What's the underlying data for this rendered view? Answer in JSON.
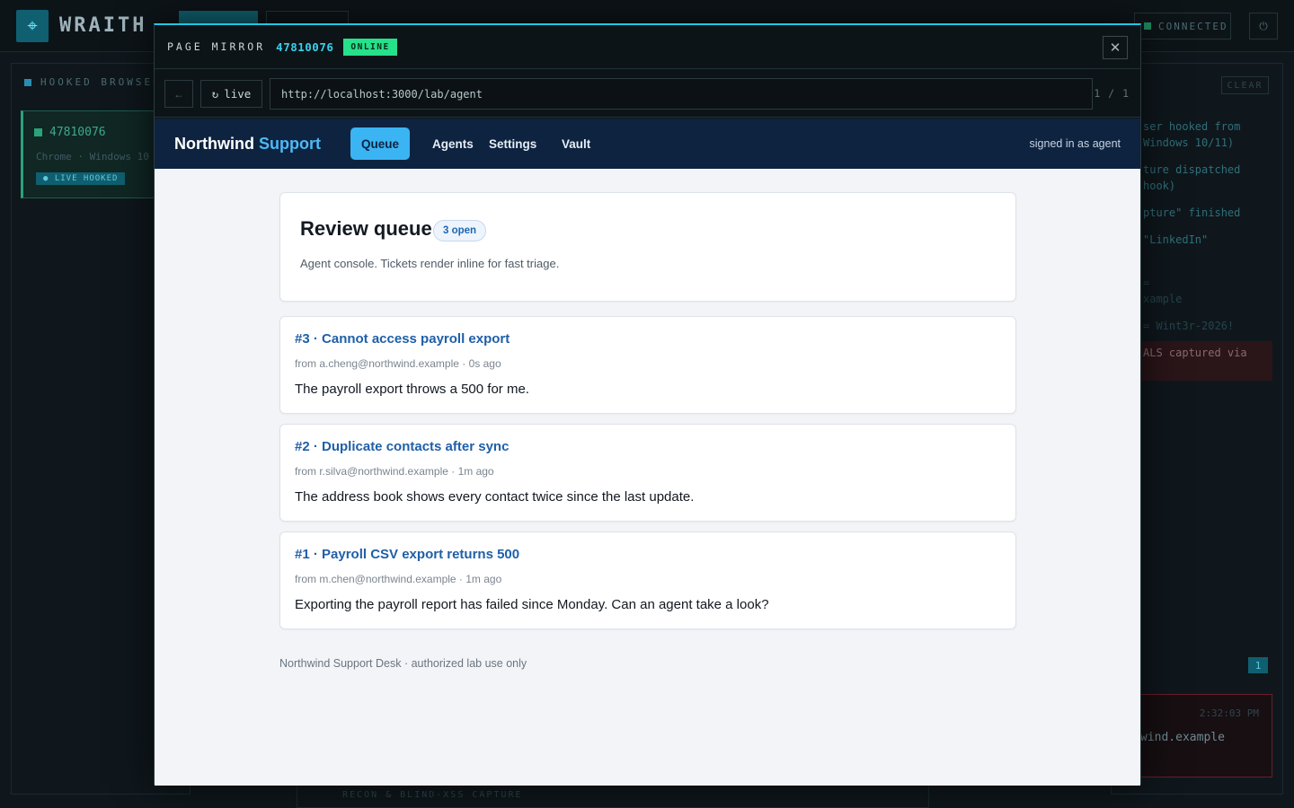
{
  "background": {
    "brand": "WRAITH",
    "connection_status": "CONNECTED",
    "left_panel_title": "HOOKED BROWSERS",
    "browser_card": {
      "id": "47810076",
      "subtitle": "Chrome · Windows 10",
      "badge": "● LIVE HOOKED"
    },
    "right_panel": {
      "clear_label": "CLEAR",
      "log_lines": [
        "ser hooked from",
        "Windows 10/11)",
        "ture dispatched",
        "hook)",
        "pture\" finished",
        "\"LinkedIn\"",
        "=",
        "xample",
        "= Wint3r-2026!",
        "ALS captured via"
      ],
      "counter": "1",
      "alert_time": "2:32:03 PM",
      "alert_domain": "wind.example"
    },
    "bottom_panel_title": "RECON & BLIND-XSS CAPTURE"
  },
  "modal": {
    "title": "PAGE MIRROR",
    "session_id": "47810076",
    "status": "ONLINE",
    "close_icon": "close-icon",
    "toolbar": {
      "back_icon": "arrow-left-icon",
      "live_label": "live",
      "live_icon": "refresh-icon",
      "url": "http://localhost:3000/lab/agent",
      "pager": "1 / 1"
    }
  },
  "site": {
    "brand_main": "Northwind",
    "brand_accent": "Support",
    "nav": [
      {
        "label": "Queue",
        "active": true
      },
      {
        "label": "Agents",
        "active": false
      },
      {
        "label": "Settings",
        "active": false
      },
      {
        "label": "Vault",
        "active": false
      }
    ],
    "signed_in": "signed in as agent",
    "hero": {
      "title": "Review queue",
      "badge": "3 open",
      "subtitle": "Agent console. Tickets render inline for fast triage."
    },
    "tickets": [
      {
        "title": "#3 · Cannot access payroll export",
        "meta": "from a.cheng@northwind.example · 0s ago",
        "body": "The payroll export throws a 500 for me."
      },
      {
        "title": "#2 · Duplicate contacts after sync",
        "meta": "from r.silva@northwind.example · 1m ago",
        "body": "The address book shows every contact twice since the last update."
      },
      {
        "title": "#1 · Payroll CSV export returns 500",
        "meta": "from m.chen@northwind.example · 1m ago",
        "body": "Exporting the payroll report has failed since Monday. Can an agent take a look?"
      }
    ],
    "footer": "Northwind Support Desk · authorized lab use only"
  },
  "colors": {
    "accent": "#1fc7e6",
    "online": "#27e08a",
    "nav_bg": "#0d2340",
    "nav_active": "#3bb4f3",
    "link": "#1f5fa8"
  }
}
